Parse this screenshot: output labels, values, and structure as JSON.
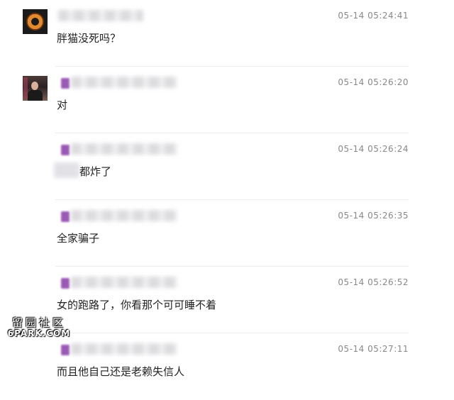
{
  "comments": [
    {
      "avatar": "orange-ring-avatar",
      "time": "05-14 05:24:41",
      "text": "胖猫没死吗？"
    },
    {
      "avatar": "photo-avatar",
      "time": "05-14 05:26:20",
      "text": "对"
    },
    {
      "avatar": "none",
      "time": "05-14 05:26:24",
      "text": "都炸了"
    },
    {
      "avatar": "none",
      "time": "05-14 05:26:35",
      "text": "全家骗子"
    },
    {
      "avatar": "none",
      "time": "05-14 05:26:52",
      "text": "女的跑路了，你看那个可可睡不着"
    },
    {
      "avatar": "none",
      "time": "05-14 05:27:11",
      "text": "而且他自己还是老赖失信人"
    }
  ],
  "watermark": {
    "chinese": "留园社区",
    "site": "6PARK.COM"
  },
  "colors": {
    "badge": "#9b59b6",
    "time": "#888888",
    "divider": "#ececec",
    "text": "#222222"
  }
}
